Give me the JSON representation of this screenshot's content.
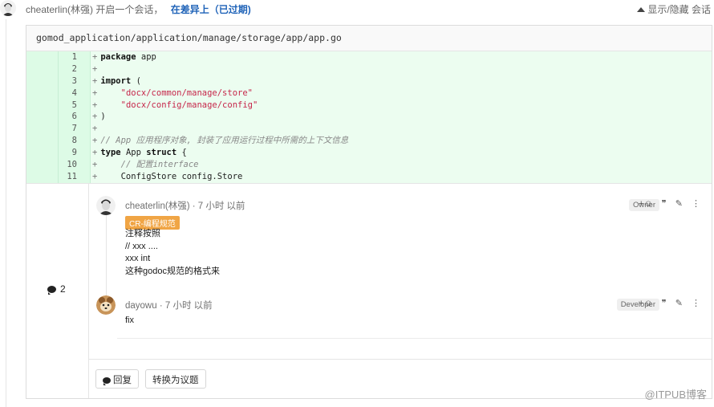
{
  "header": {
    "author": "cheaterlin(林强)",
    "action": "开启一个会话，",
    "link": "在差异上（已过期)",
    "toggle_label": "显示/隐藏 会话"
  },
  "file": {
    "path": "gomod_application/application/manage/storage/app/app.go"
  },
  "diff_lines": [
    {
      "n": "1",
      "parts": [
        {
          "t": "package",
          "c": "kw"
        },
        {
          "t": " app",
          "c": ""
        }
      ]
    },
    {
      "n": "2",
      "parts": []
    },
    {
      "n": "3",
      "parts": [
        {
          "t": "import",
          "c": "kw"
        },
        {
          "t": " (",
          "c": ""
        }
      ]
    },
    {
      "n": "4",
      "parts": [
        {
          "t": "    ",
          "c": ""
        },
        {
          "t": "\"docx/common/manage/store\"",
          "c": "str"
        }
      ]
    },
    {
      "n": "5",
      "parts": [
        {
          "t": "    ",
          "c": ""
        },
        {
          "t": "\"docx/config/manage/config\"",
          "c": "str"
        }
      ]
    },
    {
      "n": "6",
      "parts": [
        {
          "t": ")",
          "c": ""
        }
      ]
    },
    {
      "n": "7",
      "parts": []
    },
    {
      "n": "8",
      "parts": [
        {
          "t": "// App 应用程序对象, 封装了应用运行过程中所需的上下文信息",
          "c": "cmt"
        }
      ]
    },
    {
      "n": "9",
      "parts": [
        {
          "t": "type",
          "c": "kw"
        },
        {
          "t": " App ",
          "c": ""
        },
        {
          "t": "struct",
          "c": "kw"
        },
        {
          "t": " {",
          "c": ""
        }
      ]
    },
    {
      "n": "10",
      "parts": [
        {
          "t": "    ",
          "c": ""
        },
        {
          "t": "// 配置interface",
          "c": "cmt"
        }
      ]
    },
    {
      "n": "11",
      "parts": [
        {
          "t": "    ConfigStore config.Store",
          "c": ""
        }
      ]
    }
  ],
  "discussion": {
    "count": "2",
    "notes": [
      {
        "author": "cheaterlin(林强)",
        "time": " · 7 小时 以前",
        "role": "Owner",
        "label": "CR-编程规范",
        "body": "注释按照\n// xxx ....\nxxx int\n这种godoc规范的格式来"
      },
      {
        "author": "dayowu",
        "time": " · 7 小时 以前",
        "role": "Developer",
        "body": "fix"
      }
    ],
    "actions": {
      "emoji": "+☺",
      "quote": "❞",
      "edit": "✎",
      "more": "⋮"
    }
  },
  "reply": {
    "reply_label": "回复",
    "issue_label": "转换为议题"
  },
  "watermark": "@ITPUB博客",
  "icons": {
    "comment": "comment-icon",
    "caret": "caret-up-icon"
  }
}
